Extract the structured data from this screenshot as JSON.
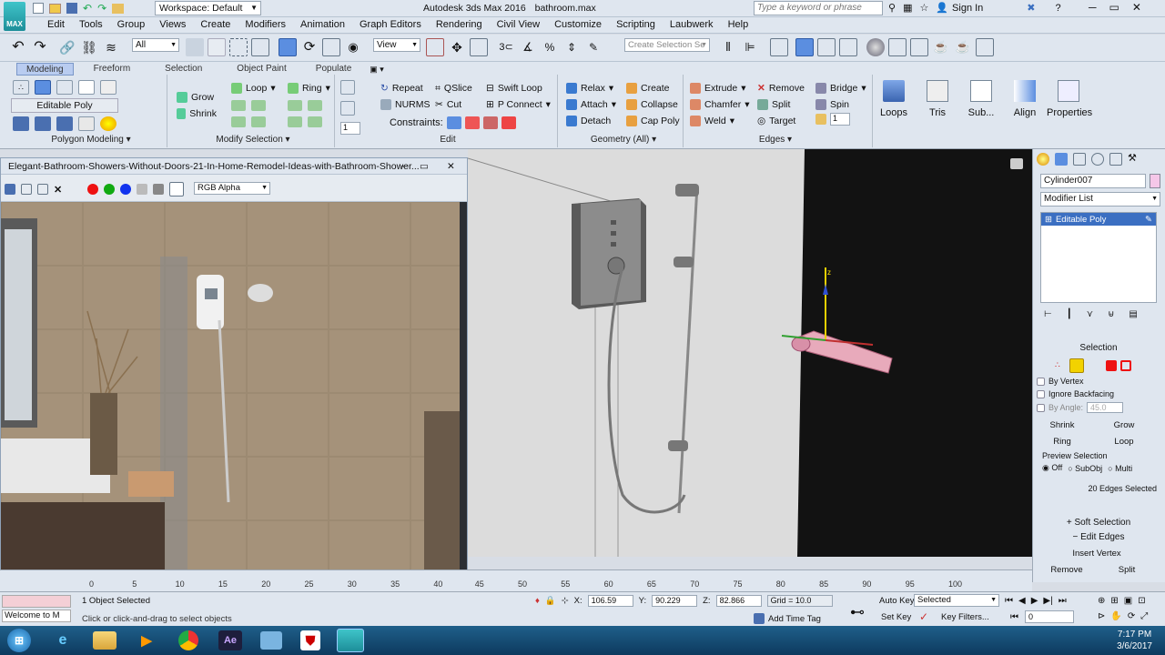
{
  "app": {
    "title": "Autodesk 3ds Max 2016",
    "filename": "bathroom.max",
    "workspace": "Workspace: Default",
    "logo_text": "MAX",
    "search_placeholder": "Type a keyword or phrase",
    "sign_in": "Sign In"
  },
  "menus": [
    "Edit",
    "Tools",
    "Group",
    "Views",
    "Create",
    "Modifiers",
    "Animation",
    "Graph Editors",
    "Rendering",
    "Civil View",
    "Customize",
    "Scripting",
    "Laubwerk",
    "Help"
  ],
  "toolbar": {
    "selection_filter": "All",
    "ref_coord": "View",
    "named_selection_placeholder": "Create Selection Se"
  },
  "ribbon": {
    "tabs": [
      "Modeling",
      "Freeform",
      "Selection",
      "Object Paint",
      "Populate"
    ],
    "active_tab": "Modeling",
    "sections": {
      "polygon_modeling": {
        "label": "Polygon Modeling",
        "mode": "Editable Poly"
      },
      "modify_selection": {
        "label": "Modify Selection",
        "items": [
          "Grow",
          "Shrink",
          "Loop",
          "Ring"
        ]
      },
      "edit": {
        "label": "Edit",
        "items": [
          "Repeat",
          "QSlice",
          "Swift Loop",
          "NURMS",
          "Cut",
          "P Connect"
        ],
        "constraints_label": "Constraints:",
        "stepper_value": "1"
      },
      "geometry": {
        "label": "Geometry (All)",
        "items": [
          "Relax",
          "Create",
          "Attach",
          "Collapse",
          "Detach",
          "Cap Poly"
        ]
      },
      "edges": {
        "label": "Edges",
        "items": [
          "Extrude",
          "Remove",
          "Bridge",
          "Chamfer",
          "Split",
          "Spin",
          "Weld",
          "Target"
        ]
      },
      "big_buttons": [
        "Loops",
        "Tris",
        "Sub...",
        "Align",
        "Properties"
      ]
    }
  },
  "image_window": {
    "title": "Elegant-Bathroom-Showers-Without-Doors-21-In-Home-Remodel-Ideas-with-Bathroom-Shower...",
    "channel": "RGB Alpha"
  },
  "command_panel": {
    "object_name": "Cylinder007",
    "modifier_list": "Modifier List",
    "stack_item": "Editable Poly",
    "selection_header": "Selection",
    "by_vertex": "By Vertex",
    "ignore_backfacing": "Ignore Backfacing",
    "by_angle": "By Angle:",
    "by_angle_value": "45.0",
    "shrink": "Shrink",
    "grow": "Grow",
    "ring": "Ring",
    "loop": "Loop",
    "preview_selection": "Preview Selection",
    "preview_options": [
      "Off",
      "SubObj",
      "Multi"
    ],
    "selection_count": "20 Edges Selected",
    "soft_selection": "Soft Selection",
    "edit_edges": "Edit Edges",
    "insert_vertex": "Insert Vertex",
    "remove": "Remove",
    "split": "Split"
  },
  "timeline": {
    "ticks": [
      "0",
      "5",
      "10",
      "15",
      "20",
      "25",
      "30",
      "35",
      "40",
      "45",
      "50",
      "55",
      "60",
      "65",
      "70",
      "75",
      "80",
      "85",
      "90",
      "95",
      "100"
    ]
  },
  "status": {
    "maxscript": "Welcome to M",
    "selected_count": "1 Object Selected",
    "prompt": "Click or click-and-drag to select objects",
    "x_label": "X:",
    "x": "106.59",
    "y_label": "Y:",
    "y": "90.229",
    "z_label": "Z:",
    "z": "82.866",
    "grid": "Grid = 10.0",
    "add_time_tag": "Add Time Tag",
    "auto_key": "Auto Key",
    "set_key": "Set Key",
    "key_filter": "Selected",
    "key_filters_btn": "Key Filters...",
    "frame": "0"
  },
  "taskbar": {
    "time": "7:17 PM",
    "date": "3/6/2017",
    "apps": [
      "start",
      "ie",
      "explorer",
      "media",
      "chrome",
      "ae",
      "win",
      "pdf",
      "max"
    ]
  },
  "colors": {
    "accent": "#3b6fc2",
    "selection": "#c8d8ff"
  }
}
